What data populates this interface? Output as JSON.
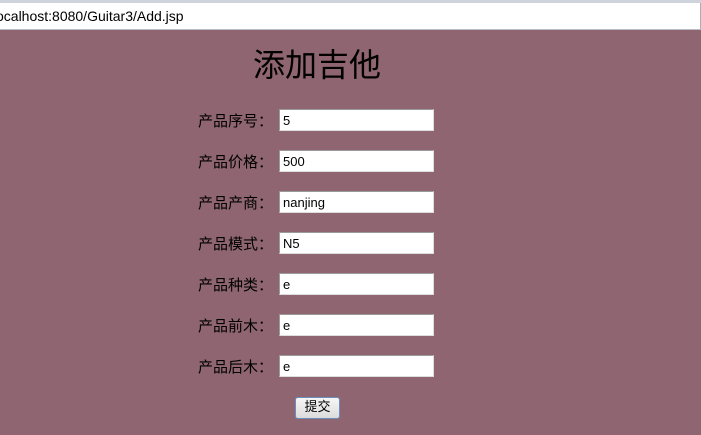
{
  "browser": {
    "url": "ocalhost:8080/Guitar3/Add.jsp"
  },
  "form": {
    "title": "添加吉他",
    "fields": [
      {
        "label": "产品序号：",
        "value": "5"
      },
      {
        "label": "产品价格：",
        "value": "500"
      },
      {
        "label": "产品产商：",
        "value": "nanjing"
      },
      {
        "label": "产品模式：",
        "value": "N5"
      },
      {
        "label": "产品种类：",
        "value": "e"
      },
      {
        "label": "产品前木：",
        "value": "e"
      },
      {
        "label": "产品后木：",
        "value": "e"
      }
    ],
    "submit_label": "提交"
  },
  "colors": {
    "page_background": "#8e6570"
  }
}
